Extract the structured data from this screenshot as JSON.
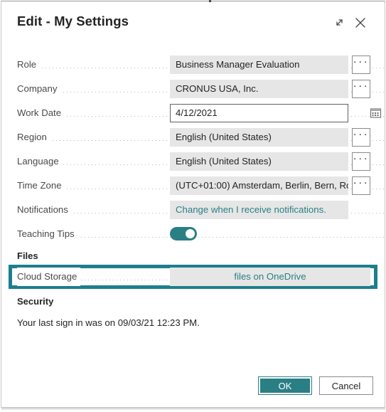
{
  "window": {
    "title": "Edit - My Settings",
    "expand_icon": "expand-diagonal-icon",
    "close_icon": "close-icon"
  },
  "colors": {
    "accent_teal": "#2a7f85",
    "highlight_teal": "#1d7f8c",
    "field_background": "#e6e6e6",
    "label_text": "#4a4a4a",
    "value_text": "#252423"
  },
  "fields": [
    {
      "label": "Role",
      "value": "Business Manager Evaluation",
      "assist": "ellipsis",
      "state": "normal"
    },
    {
      "label": "Company",
      "value": "CRONUS USA, Inc.",
      "assist": "ellipsis",
      "state": "normal"
    },
    {
      "label": "Work Date",
      "value": "4/12/2021",
      "assist": "calendar",
      "state": "focused"
    },
    {
      "label": "Region",
      "value": "English (United States)",
      "assist": "ellipsis",
      "state": "normal"
    },
    {
      "label": "Language",
      "value": "English (United States)",
      "assist": "ellipsis",
      "state": "normal"
    },
    {
      "label": "Time Zone",
      "value": "(UTC+01:00) Amsterdam, Berlin, Bern, Ro...",
      "assist": "ellipsis",
      "state": "normal"
    },
    {
      "label": "Notifications",
      "value": "Change when I receive notifications.",
      "assist": "none",
      "state": "link"
    },
    {
      "label": "Teaching Tips",
      "value": "",
      "assist": "toggle",
      "state": "toggle-on"
    }
  ],
  "files_section": {
    "caption": "Files",
    "cloud_storage": {
      "label": "Cloud Storage",
      "link_text": "files on OneDrive",
      "highlighted": true
    }
  },
  "security_section": {
    "caption": "Security",
    "last_sign_in": "Your last sign in was on 09/03/21 12:23 PM."
  },
  "footer": {
    "ok_label": "OK",
    "cancel_label": "Cancel"
  }
}
